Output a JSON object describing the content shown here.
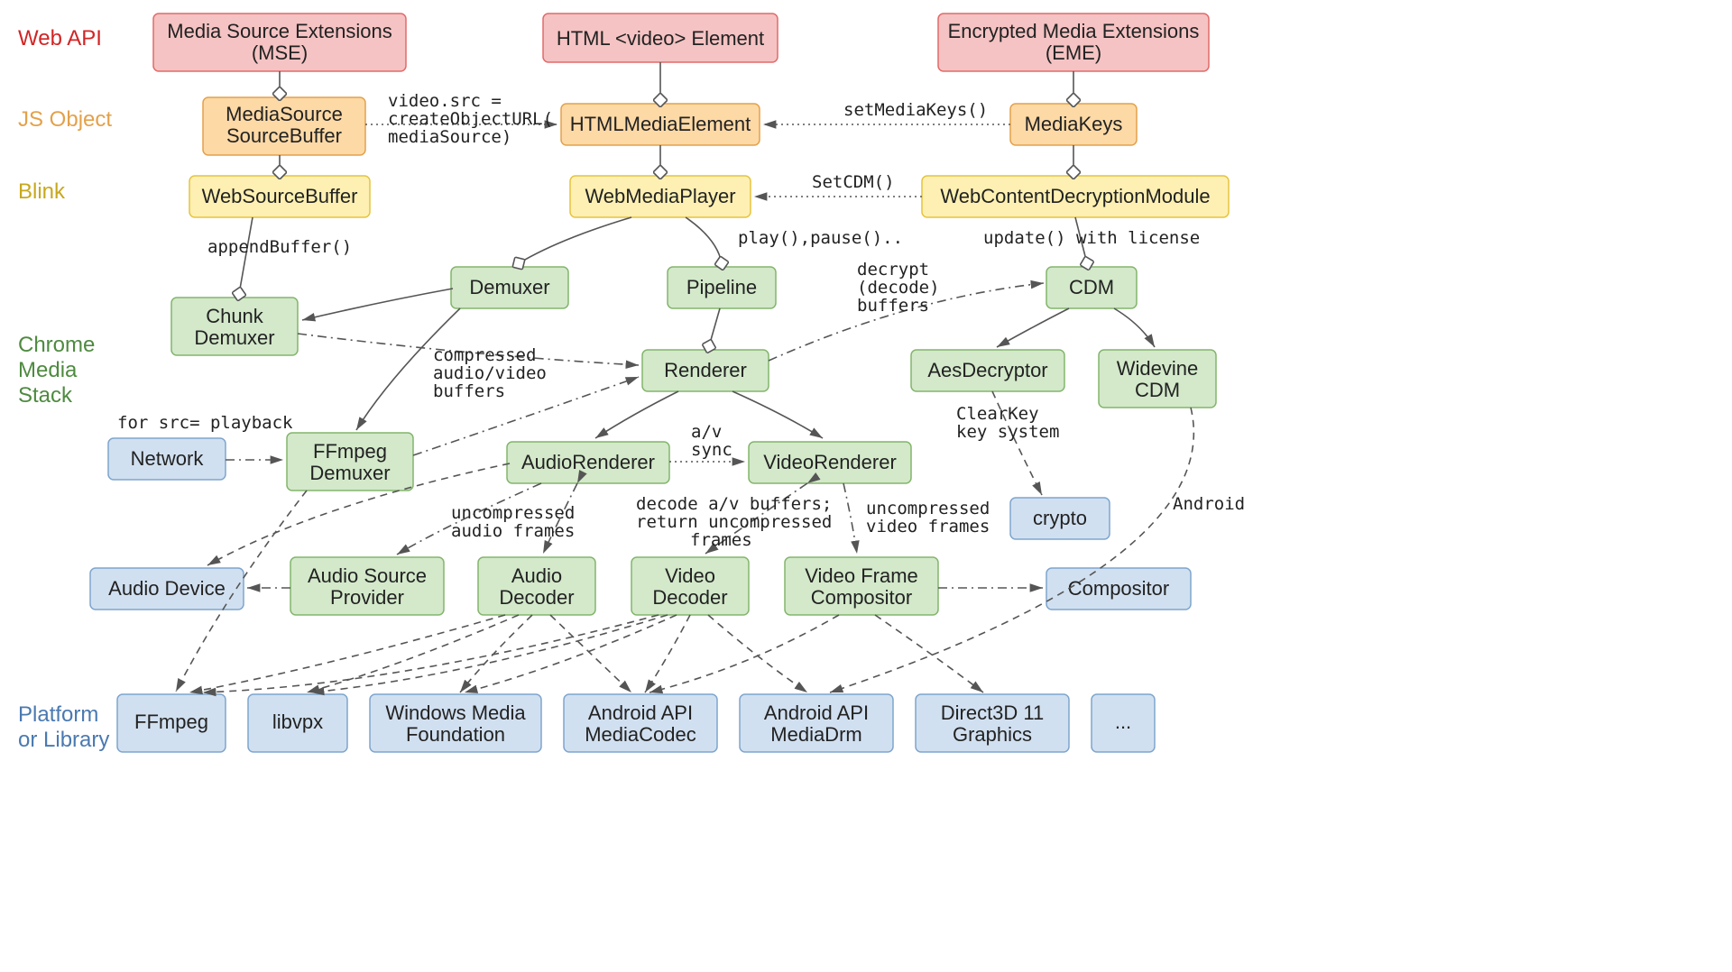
{
  "rows": {
    "webapi": "Web API",
    "jsobject": "JS Object",
    "blink": "Blink",
    "chrome1": "Chrome",
    "chrome2": "Media",
    "chrome3": "Stack",
    "platform1": "Platform",
    "platform2": "or Library"
  },
  "nodes": {
    "mse1": "Media Source Extensions",
    "mse2": "(MSE)",
    "video": "HTML <video> Element",
    "eme1": "Encrypted Media Extensions",
    "eme2": "(EME)",
    "mssb1": "MediaSource",
    "mssb2": "SourceBuffer",
    "htmlme": "HTMLMediaElement",
    "mkeys": "MediaKeys",
    "wsb": "WebSourceBuffer",
    "wmp": "WebMediaPlayer",
    "wcdm": "WebContentDecryptionModule",
    "chunk1": "Chunk",
    "chunk2": "Demuxer",
    "demux": "Demuxer",
    "pipe": "Pipeline",
    "cdm": "CDM",
    "rend": "Renderer",
    "aes": "AesDecryptor",
    "wide1": "Widevine",
    "wide2": "CDM",
    "net": "Network",
    "ffd1": "FFmpeg",
    "ffd2": "Demuxer",
    "ar": "AudioRenderer",
    "vr": "VideoRenderer",
    "crypto": "crypto",
    "adev": "Audio Device",
    "asp1": "Audio Source",
    "asp2": "Provider",
    "adec1": "Audio",
    "adec2": "Decoder",
    "vdec1": "Video",
    "vdec2": "Decoder",
    "vfc1": "Video Frame",
    "vfc2": "Compositor",
    "comp": "Compositor",
    "ffmpeg": "FFmpeg",
    "libvpx": "libvpx",
    "wmf1": "Windows Media",
    "wmf2": "Foundation",
    "amc1": "Android API",
    "amc2": "MediaCodec",
    "amd1": "Android API",
    "amd2": "MediaDrm",
    "d3d1": "Direct3D 11",
    "d3d2": "Graphics",
    "dots": "..."
  },
  "edge_labels": {
    "srce1": "video.src =",
    "srce2": "createObjectURL(",
    "srce3": "mediaSource)",
    "setmk": "setMediaKeys()",
    "setcdm": "SetCDM()",
    "appbuf": "appendBuffer()",
    "play": "play(),pause()..",
    "upd": "update() with license",
    "srcpb": "for src= playback",
    "comp1": "compressed",
    "comp2": "audio/video",
    "comp3": "buffers",
    "dec1": "decrypt",
    "dec2": "(decode)",
    "dec3": "buffers",
    "avsync1": "a/v",
    "avsync2": "sync",
    "clear1": "ClearKey",
    "clear2": "key system",
    "uaf1": "uncompressed",
    "uaf2": "audio frames",
    "dab1": "decode a/v buffers;",
    "dab2": "return uncompressed",
    "dab3": "frames",
    "uvf1": "uncompressed",
    "uvf2": "video frames",
    "android": "Android"
  }
}
